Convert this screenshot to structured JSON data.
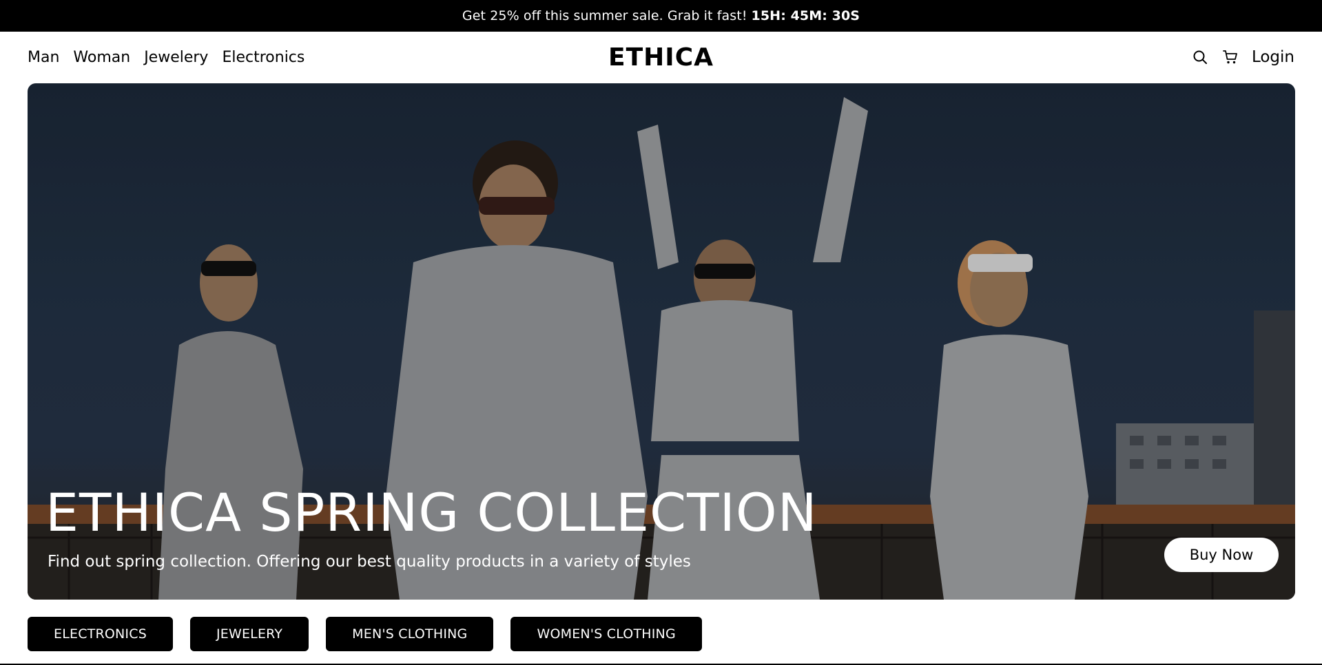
{
  "announcement": {
    "text": "Get 25% off this summer sale. Grab it fast!",
    "timer": "15H: 45M: 30S"
  },
  "nav": {
    "links": [
      "Man",
      "Woman",
      "Jewelery",
      "Electronics"
    ],
    "logo": "ETHICA",
    "login": "Login",
    "icons": [
      "search-icon",
      "cart-icon"
    ]
  },
  "hero": {
    "title": "ETHICA SPRING COLLECTION",
    "subtitle": "Find out spring collection. Offering our best quality products in a variety of styles",
    "cta": "Buy Now"
  },
  "categories": [
    "ELECTRONICS",
    "JEWELERY",
    "MEN'S CLOTHING",
    "WOMEN'S CLOTHING"
  ],
  "colors": {
    "bar": "#000000",
    "background": "#ffffff",
    "hero_sky": "#1d2a3b"
  }
}
